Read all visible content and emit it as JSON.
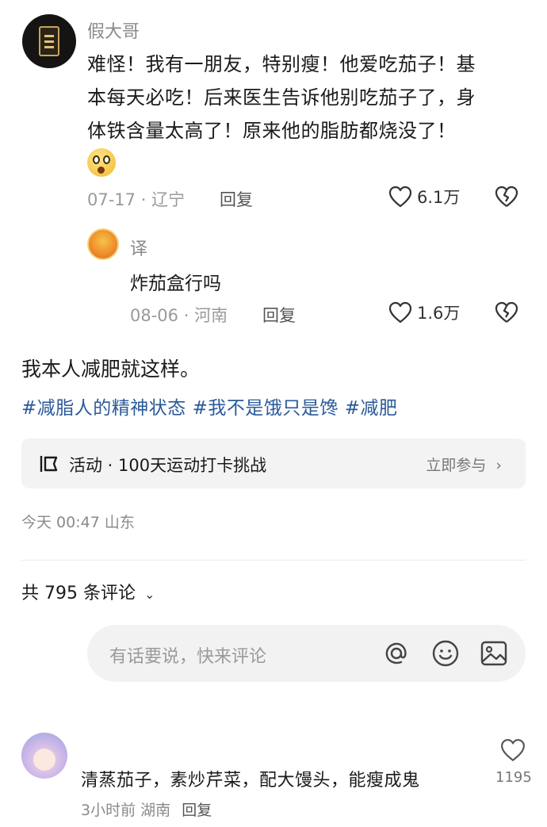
{
  "comment1": {
    "username": "假大哥",
    "text_lines": [
      "难怪！我有一朋友，特别瘦！他爱吃茄子！基",
      "本每天必吃！后来医生告诉他别吃茄子了，身",
      "体铁含量太高了！原来他的脂肪都烧没了！"
    ],
    "emoji": "surprised-face",
    "date": "07-17",
    "location": "辽宁",
    "reply_label": "回复",
    "likes": "6.1万"
  },
  "reply1": {
    "username": "译",
    "text": "炸茄盒行吗",
    "date": "08-06",
    "location": "河南",
    "reply_label": "回复",
    "likes": "1.6万"
  },
  "post": {
    "text": "我本人减肥就这样。",
    "tags": [
      "#减脂人的精神状态",
      "#我不是饿只是馋",
      "#减肥"
    ],
    "activity_label": "活动 · 100天运动打卡挑战",
    "activity_action": "立即参与",
    "time": "今天 00:47",
    "location": "山东"
  },
  "comments_header": {
    "label": "共 795 条评论"
  },
  "input": {
    "placeholder": "有话要说，快来评论"
  },
  "comment2": {
    "text": "清蒸茄子，素炒芹菜，配大馒头，能瘦成鬼",
    "time": "3小时前",
    "location": "湖南",
    "reply_label": "回复",
    "likes": "1195"
  },
  "colors": {
    "tag": "#2a5a9a",
    "meta": "#9a9a9a",
    "activity_bg": "#f3f3f3",
    "input_bg": "#f2f2f2"
  }
}
